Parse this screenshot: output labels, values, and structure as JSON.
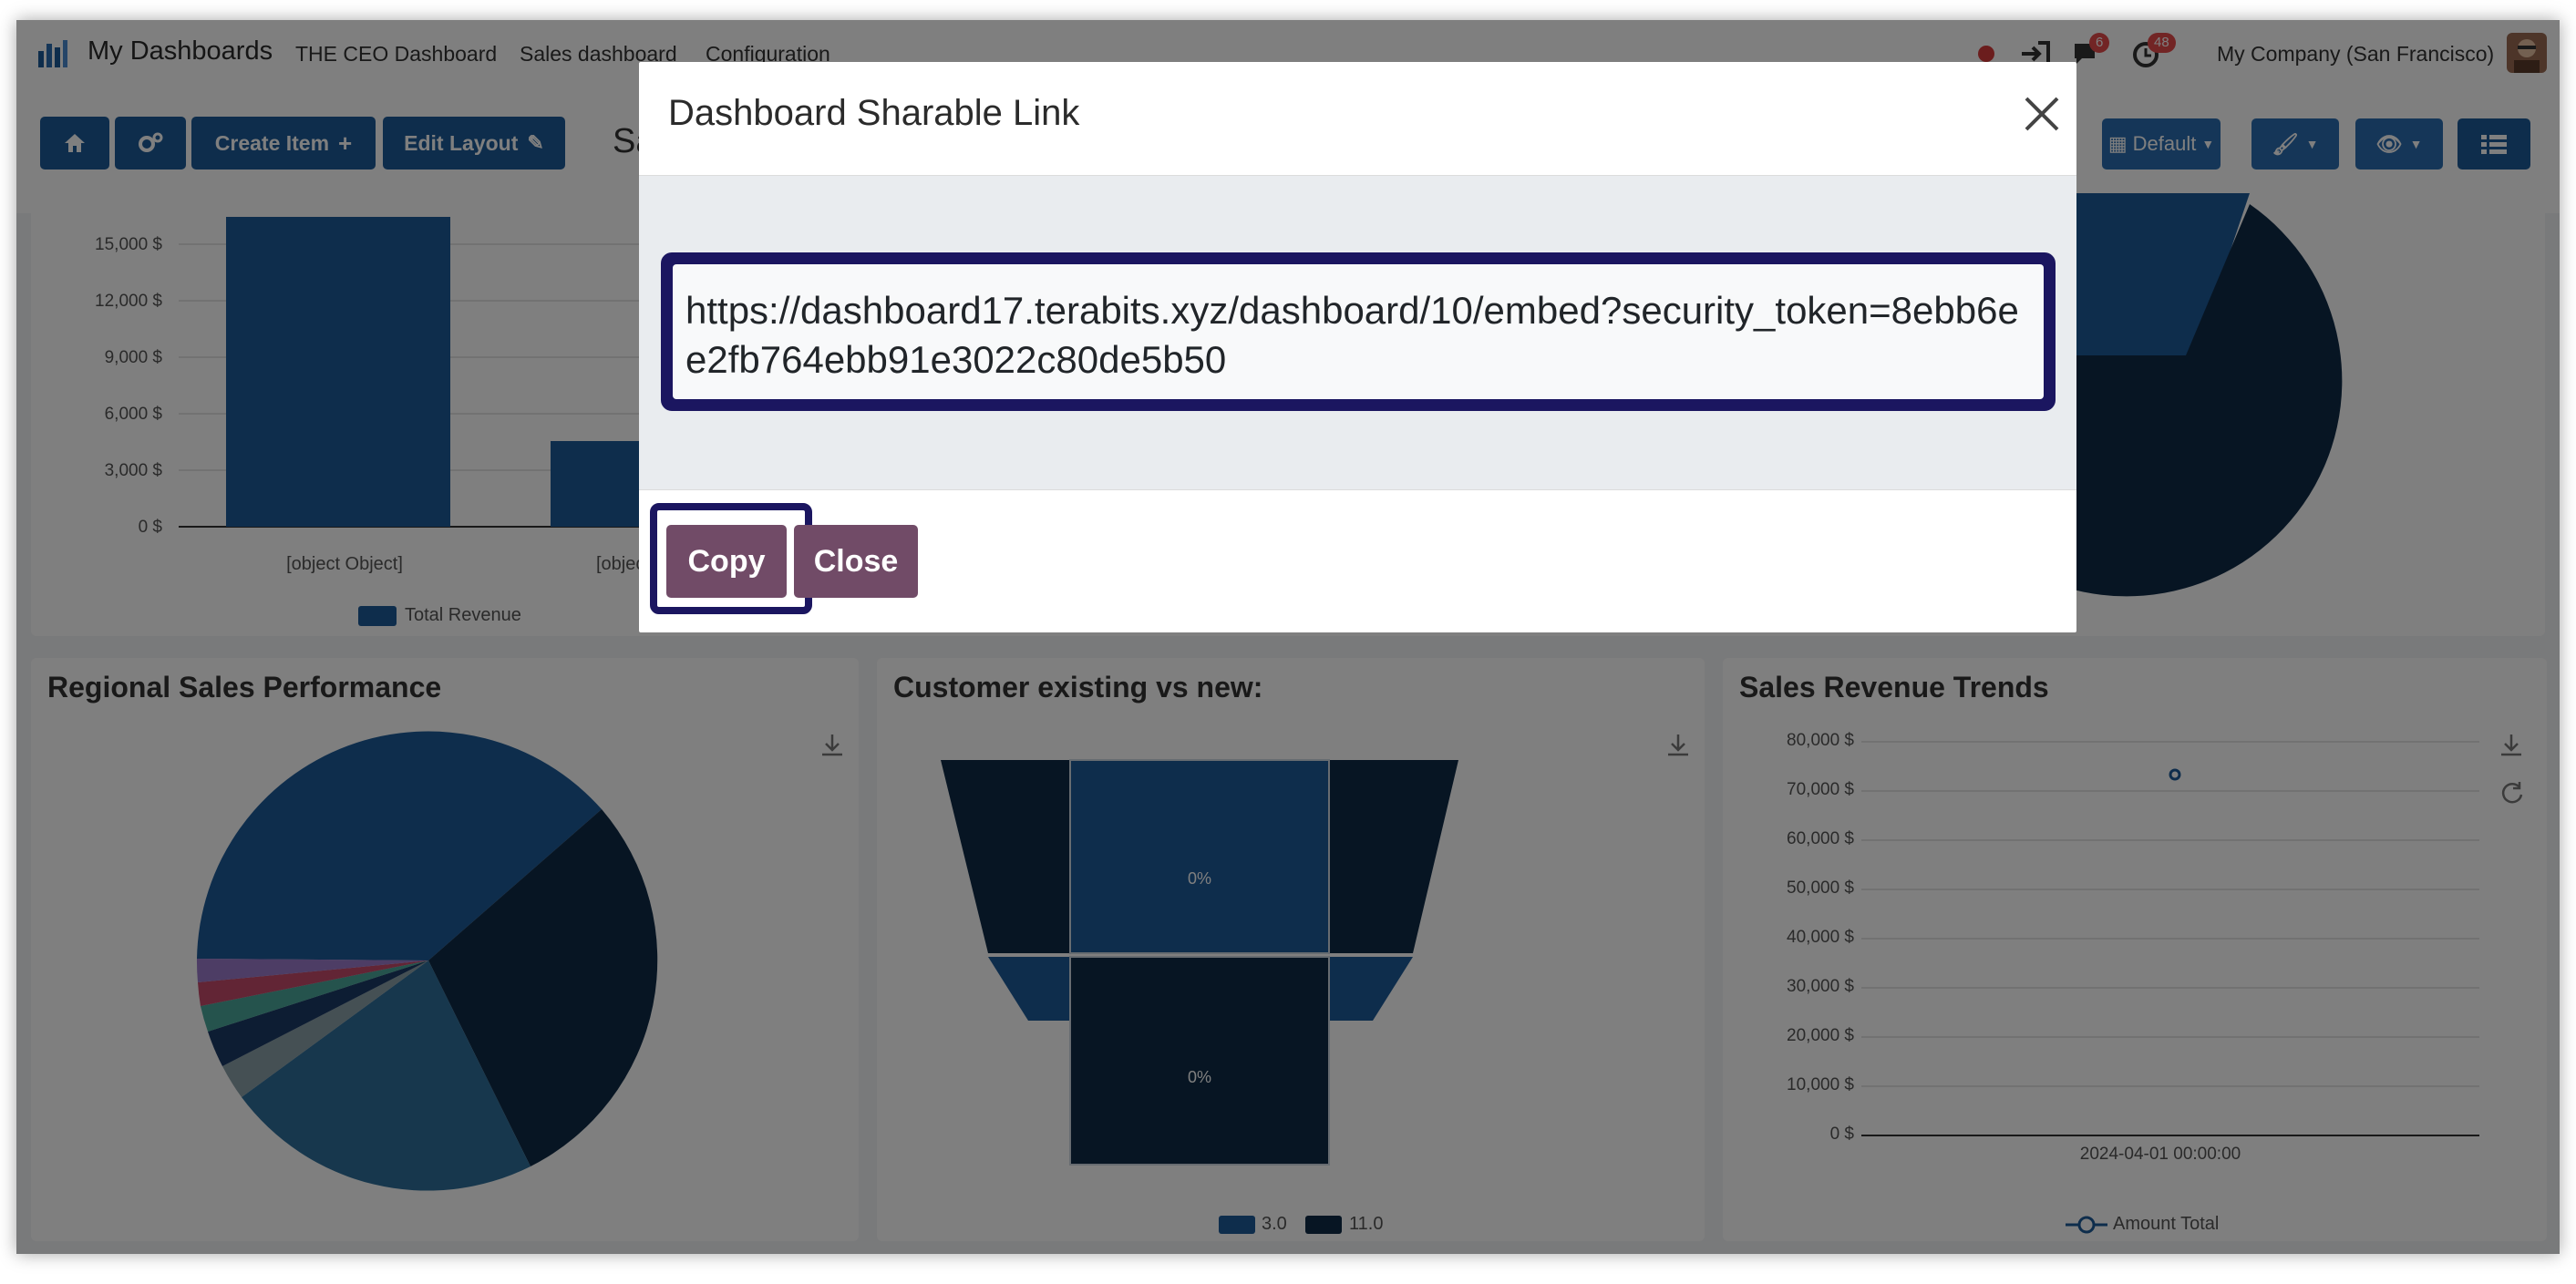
{
  "navbar": {
    "app_name": "My Dashboards",
    "menu": [
      "THE CEO Dashboard",
      "Sales dashboard",
      "Configuration"
    ],
    "badges": {
      "chat": "6",
      "activity": "48"
    },
    "company": "My Company (San Francisco)"
  },
  "toolbar": {
    "create_item": "Create Item",
    "edit_layout": "Edit Layout",
    "title_partial": "Sa",
    "date_filter": "Default"
  },
  "bar_chart": {
    "y_ticks": [
      "15,000 $",
      "12,000 $",
      "9,000 $",
      "6,000 $",
      "3,000 $",
      "0 $"
    ],
    "x_labels": [
      "[object Object]",
      "[object"
    ],
    "legend": "Total Revenue"
  },
  "regional": {
    "title": "Regional Sales Performance"
  },
  "customer": {
    "title": "Customer existing vs new:",
    "funnel_labels": [
      "0%",
      "0%"
    ],
    "legend": [
      "3.0",
      "11.0"
    ]
  },
  "trends": {
    "title": "Sales Revenue Trends",
    "y_ticks": [
      "80,000 $",
      "70,000 $",
      "60,000 $",
      "50,000 $",
      "40,000 $",
      "30,000 $",
      "20,000 $",
      "10,000 $",
      "0 $"
    ],
    "x_label": "2024-04-01 00:00:00",
    "legend": "Amount Total"
  },
  "modal": {
    "title": "Dashboard Sharable Link",
    "link": "https://dashboard17.terabits.xyz/dashboard/10/embed?security_token=8ebb6ee2fb764ebb91e3022c80de5b50",
    "copy_label": "Copy",
    "close_label": "Close"
  },
  "colors": {
    "primary": "#1d5a98",
    "dark_navy": "#0e2a47",
    "modal_button": "#714b67",
    "highlight_outline": "#1b1660"
  }
}
